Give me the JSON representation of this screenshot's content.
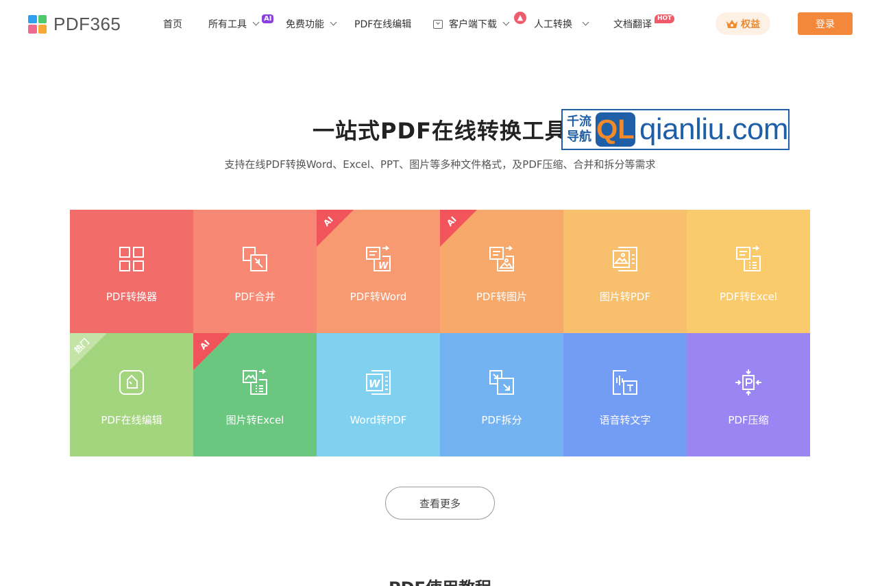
{
  "brand": {
    "name": "PDF365",
    "logo_colors": [
      "#2f9fef",
      "#4cc96b",
      "#f06a8f",
      "#f6a935"
    ]
  },
  "nav": {
    "items": [
      {
        "label": "首页"
      },
      {
        "label": "所有工具",
        "badge": "AI"
      },
      {
        "label": "免费功能"
      },
      {
        "label": "PDF在线编辑"
      },
      {
        "label": "客户端下载"
      },
      {
        "label": "人工转换"
      },
      {
        "label": "文档翻译",
        "badge": "HOT"
      }
    ],
    "rights_label": "权益",
    "login_label": "登录"
  },
  "hero": {
    "title": "一站式PDF在线转换工具",
    "subtitle": "支持在线PDF转换Word、Excel、PPT、图片等多种文件格式，及PDF压缩、合并和拆分等需求"
  },
  "watermark": {
    "cn_line1": "千流",
    "cn_line2": "导航",
    "logo": "QL",
    "domain": "qianliu.com"
  },
  "tools": [
    {
      "label": "PDF转换器",
      "color": "#f26d6a",
      "icon": "grid-icon"
    },
    {
      "label": "PDF合并",
      "color": "#f78873",
      "icon": "merge-icon"
    },
    {
      "label": "PDF转Word",
      "color": "#f79a72",
      "icon": "pdf-to-word-icon",
      "corner": "AI"
    },
    {
      "label": "PDF转图片",
      "color": "#f7a96c",
      "icon": "pdf-to-image-icon",
      "corner": "AI"
    },
    {
      "label": "图片转PDF",
      "color": "#f8bf6c",
      "icon": "image-to-pdf-icon"
    },
    {
      "label": "PDF转Excel",
      "color": "#f9cb6c",
      "icon": "pdf-to-excel-icon"
    },
    {
      "label": "PDF在线编辑",
      "color": "#a3d57e",
      "icon": "edit-icon",
      "corner": "热门"
    },
    {
      "label": "图片转Excel",
      "color": "#6bc77f",
      "icon": "image-to-excel-icon",
      "corner": "AI"
    },
    {
      "label": "Word转PDF",
      "color": "#7fd1ef",
      "icon": "word-to-pdf-icon"
    },
    {
      "label": "PDF拆分",
      "color": "#74b3f2",
      "icon": "split-icon"
    },
    {
      "label": "语音转文字",
      "color": "#739cf4",
      "icon": "speech-to-text-icon"
    },
    {
      "label": "PDF压缩",
      "color": "#9a86f3",
      "icon": "compress-icon"
    }
  ],
  "corner_colors": {
    "AI": "#f2545b",
    "热门": "#c3e4a6"
  },
  "more_label": "查看更多",
  "section_title": "PDF使用教程",
  "colors": {
    "accent": "#f4883a",
    "rights_text": "#e98a33",
    "badge_ai": "#8a3fe0",
    "badge_hot": "#f05a6a"
  }
}
